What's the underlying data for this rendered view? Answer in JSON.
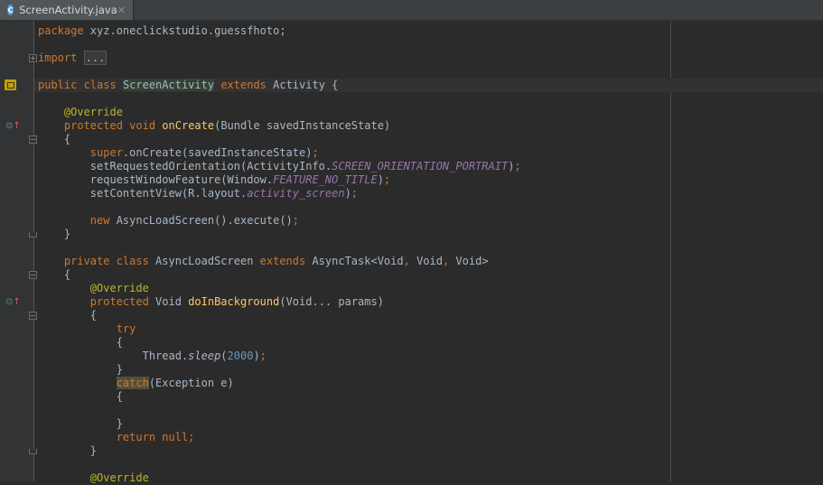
{
  "tab": {
    "icon_letter": "C",
    "label": "ScreenActivity.java",
    "close": "✕"
  },
  "gutter": {
    "markers": [
      "override-up-arrow-icon",
      "implements-up-arrow-icon",
      "class-nav-icon"
    ]
  },
  "code": {
    "lines": [
      "package xyz.oneclickstudio.guessfhoto;",
      "",
      "import ...",
      "",
      "public class ScreenActivity extends Activity {",
      "",
      "    @Override",
      "    protected void onCreate(Bundle savedInstanceState)",
      "    {",
      "",
      "        super.onCreate(savedInstanceState);",
      "        setRequestedOrientation(ActivityInfo.SCREEN_ORIENTATION_PORTRAIT);",
      "        requestWindowFeature(Window.FEATURE_NO_TITLE);",
      "        setContentView(R.layout.activity_screen);",
      "",
      "        new AsyncLoadScreen().execute();",
      "    }",
      "",
      "    private class AsyncLoadScreen extends AsyncTask<Void, Void, Void>",
      "    {",
      "        @Override",
      "        protected Void doInBackground(Void... params)",
      "        {",
      "            try",
      "            {",
      "                Thread.sleep(2000);",
      "            }",
      "            catch(Exception e)",
      "            {",
      "",
      "            }",
      "            return null;",
      "        }",
      "",
      "        @Override"
    ]
  },
  "colors": {
    "background": "#2b2b2b",
    "keyword": "#cc7832",
    "annotation": "#bbb529",
    "method": "#ffc66d",
    "number": "#6897bb",
    "static_field": "#9876aa",
    "text": "#a9b7c6"
  }
}
